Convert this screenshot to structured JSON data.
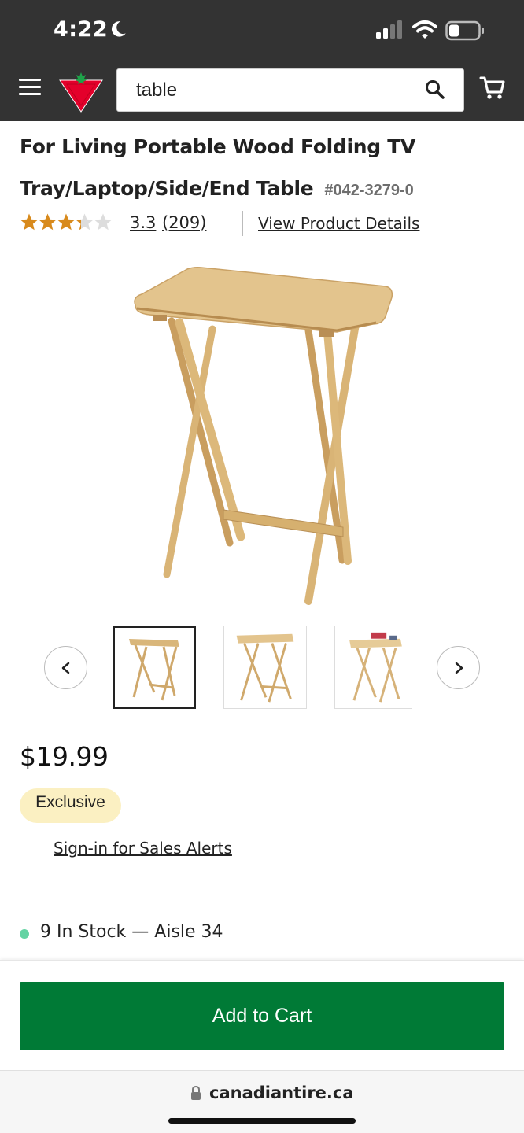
{
  "status_bar": {
    "time": "4:22",
    "battery_level": 0.35
  },
  "header": {
    "search": {
      "value": "table"
    }
  },
  "product": {
    "title": "For Living Portable Wood Folding TV Tray/Laptop/Side/End Table",
    "sku": "#042-3279-0",
    "rating": {
      "value": "3.3",
      "count": "(209)",
      "stars_filled": 3.3,
      "stars_total": 5
    },
    "details_link": "View Product Details",
    "price": "$19.99",
    "badge": "Exclusive",
    "sales_alert_link": "Sign-in for Sales Alerts",
    "stock": "9 In Stock — Aisle 34"
  },
  "actions": {
    "add_to_cart": "Add to Cart"
  },
  "browser": {
    "url": "canadiantire.ca"
  },
  "colors": {
    "header_bg": "#333333",
    "brand_red": "#e4002b",
    "add_to_cart_bg": "#007a36",
    "badge_bg": "#fbf0c2",
    "star_color": "#d88a1c",
    "stock_dot": "#64d3a3"
  }
}
